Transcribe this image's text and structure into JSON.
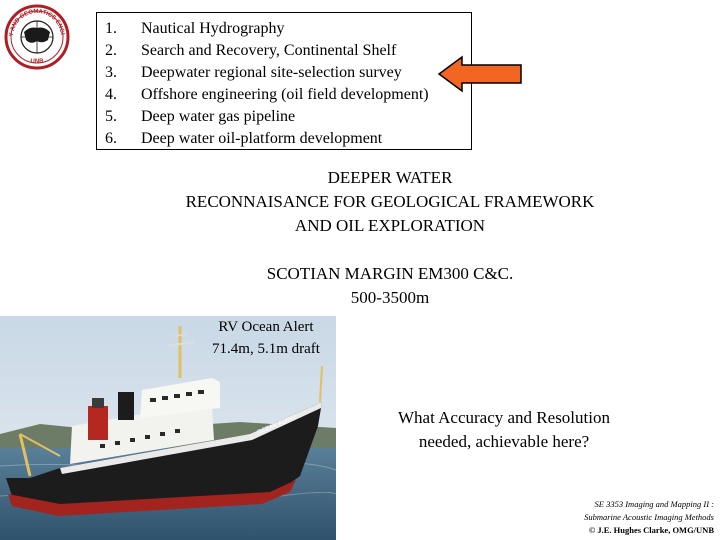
{
  "logo": {
    "text_top": "GEODESY AND GEOMATICS ENGINEERING",
    "text_bottom": "UNB"
  },
  "list": [
    {
      "num": "1.",
      "text": "Nautical Hydrography"
    },
    {
      "num": "2.",
      "text": "Search and Recovery, Continental Shelf"
    },
    {
      "num": "3.",
      "text": "Deepwater regional site-selection survey"
    },
    {
      "num": "4.",
      "text": "Offshore engineering (oil field development)"
    },
    {
      "num": "5.",
      "text": "Deep water gas pipeline"
    },
    {
      "num": "6.",
      "text": "Deep water oil-platform development"
    }
  ],
  "arrow": {
    "points_to_item": 3,
    "color": "#f26522",
    "outline": "#000000"
  },
  "heading": [
    "DEEPER WATER",
    "RECONNAISANCE FOR GEOLOGICAL FRAMEWORK",
    "AND OIL EXPLORATION"
  ],
  "margin": [
    "SCOTIAN MARGIN EM300 C&C.",
    "500-3500m"
  ],
  "ship": {
    "caption": [
      "RV Ocean Alert",
      "71.4m, 5.1m draft"
    ],
    "hull_name": "OCEAN ALERT"
  },
  "question": [
    "What Accuracy and Resolution",
    "needed, achievable here?"
  ],
  "footer": [
    "SE 3353 Imaging and Mapping II :",
    "Submarine Acoustic Imaging Methods",
    "© J.E. Hughes Clarke, OMG/UNB"
  ]
}
